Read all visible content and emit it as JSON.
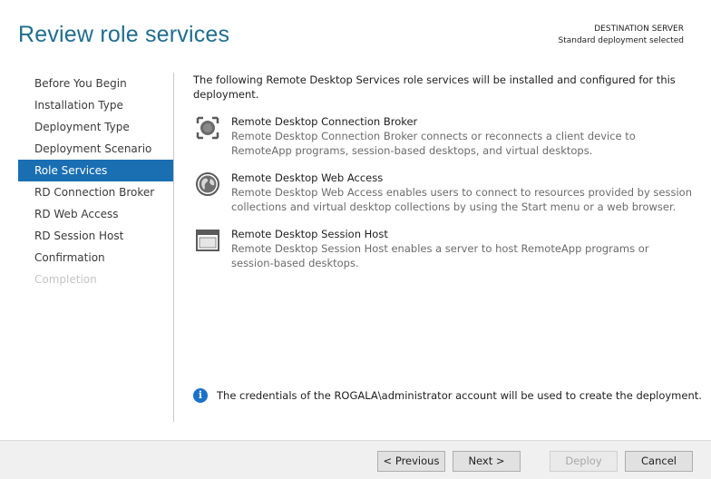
{
  "header": {
    "title": "Review role services",
    "destination_label": "DESTINATION SERVER",
    "destination_value": "Standard deployment selected"
  },
  "nav": {
    "items": [
      {
        "label": "Before You Begin",
        "state": "normal"
      },
      {
        "label": "Installation Type",
        "state": "normal"
      },
      {
        "label": "Deployment Type",
        "state": "normal"
      },
      {
        "label": "Deployment Scenario",
        "state": "normal"
      },
      {
        "label": "Role Services",
        "state": "selected"
      },
      {
        "label": "RD Connection Broker",
        "state": "normal"
      },
      {
        "label": "RD Web Access",
        "state": "normal"
      },
      {
        "label": "RD Session Host",
        "state": "normal"
      },
      {
        "label": "Confirmation",
        "state": "normal"
      },
      {
        "label": "Completion",
        "state": "disabled"
      }
    ]
  },
  "main": {
    "intro": "The following Remote Desktop Services role services will be installed and configured for this deployment.",
    "services": [
      {
        "icon": "connection-broker-icon",
        "title": "Remote Desktop Connection Broker",
        "description": "Remote Desktop Connection Broker connects or reconnects a client device to RemoteApp programs, session-based desktops, and virtual desktops."
      },
      {
        "icon": "web-access-globe-icon",
        "title": "Remote Desktop Web Access",
        "description": "Remote Desktop Web Access enables users to connect to resources provided by session collections and virtual desktop collections by using the Start menu or a web browser."
      },
      {
        "icon": "session-host-window-icon",
        "title": "Remote Desktop Session Host",
        "description": "Remote Desktop Session Host enables a server to host RemoteApp programs or session-based desktops."
      }
    ],
    "info": {
      "icon": "info-icon",
      "icon_glyph": "i",
      "text": "The credentials of the ROGALA\\administrator account will be used to create the deployment."
    }
  },
  "footer": {
    "previous_label": "< Previous",
    "next_label": "Next >",
    "deploy_label": "Deploy",
    "cancel_label": "Cancel"
  },
  "colors": {
    "title": "#1f6d8e",
    "selected_nav_bg": "#1a6fb3",
    "info_icon": "#1a73c7",
    "description_text": "#6b6b6b",
    "disabled_text": "#c4c4c4",
    "footer_bg": "#f0f0f0"
  }
}
